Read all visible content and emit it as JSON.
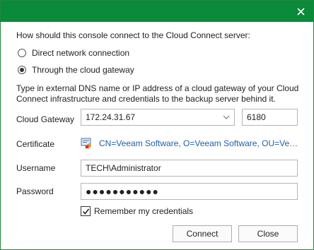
{
  "window": {
    "close_icon": "close-icon",
    "accent_color": "#0a8a3a"
  },
  "prompt": "How should this console connect to the Cloud Connect server:",
  "options": [
    {
      "label": "Direct network connection",
      "selected": false
    },
    {
      "label": "Through the cloud gateway",
      "selected": true
    }
  ],
  "hint": "Type in external DNS name or IP address of a cloud gateway of your Cloud Connect infrastructure and credentials to the backup server behind it.",
  "gateway": {
    "label": "Cloud Gateway",
    "value": "172.24.31.67",
    "port": "6180"
  },
  "certificate": {
    "label": "Certificate",
    "value": "CN=Veeam Software, O=Veeam Software, OU=Veeam Software",
    "icon": "certificate-error-icon"
  },
  "username": {
    "label": "Username",
    "value": "TECH\\Administrator"
  },
  "password": {
    "label": "Password",
    "value": "●●●●●●●●●●●"
  },
  "remember": {
    "label": "Remember my credentials",
    "checked": true
  },
  "buttons": {
    "connect": "Connect",
    "close": "Close"
  }
}
